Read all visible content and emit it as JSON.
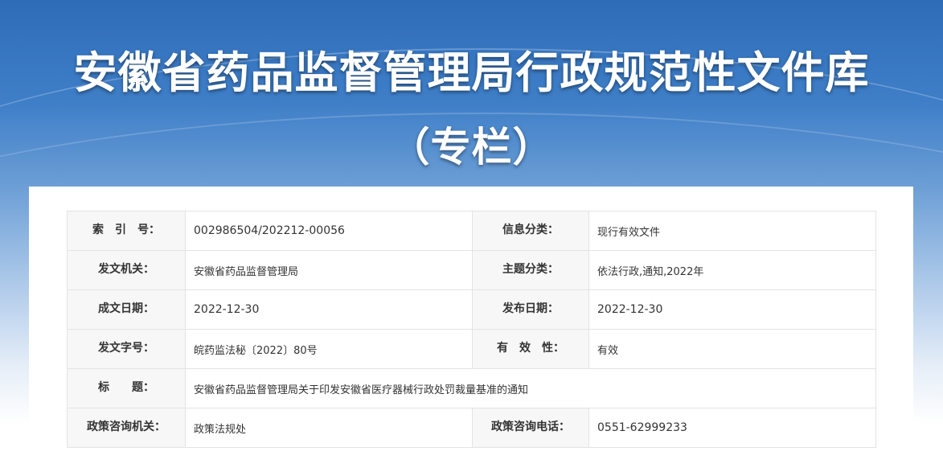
{
  "header": {
    "title": "安徽省药品监督管理局行政规范性文件库",
    "subtitle": "（专栏）"
  },
  "info": {
    "index_label": "索　引　号：",
    "index_value": "002986504/202212-00056",
    "category_label": "信息分类：",
    "category_value": "现行有效文件",
    "issuer_label": "发文机关：",
    "issuer_value": "安徽省药品监督管理局",
    "topic_label": "主题分类：",
    "topic_value": "依法行政,通知,2022年",
    "written_date_label": "成文日期：",
    "written_date_value": "2022-12-30",
    "publish_date_label": "发布日期：",
    "publish_date_value": "2022-12-30",
    "doc_number_label": "发文字号：",
    "doc_number_value": "皖药监法秘〔2022〕80号",
    "validity_label": "有　效　性：",
    "validity_value": "有效",
    "title_label": "标　　题：",
    "title_value": "安徽省药品监督管理局关于印发安徽省医疗器械行政处罚裁量基准的通知",
    "consult_org_label": "政策咨询机关：",
    "consult_org_value": "政策法规处",
    "consult_phone_label": "政策咨询电话：",
    "consult_phone_value": "0551-62999233"
  }
}
